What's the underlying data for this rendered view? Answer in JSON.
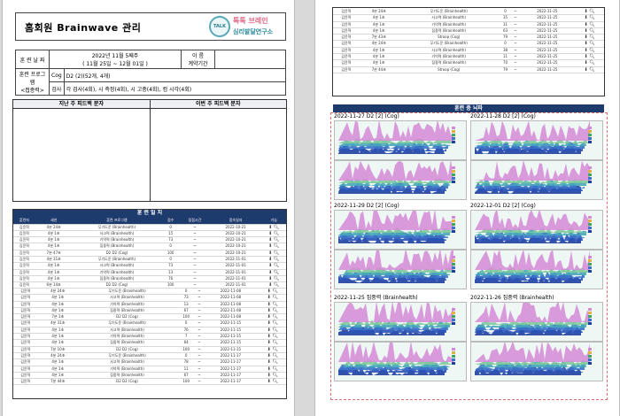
{
  "title": "홈회원 Brainwave 관리",
  "logo": {
    "line1": "톡톡 브레인",
    "line2": "심리발달연구소",
    "seal": "Brainwave"
  },
  "info": {
    "date_label": "훈 련 날 짜",
    "date_value1": "2022년 11월 5째주",
    "date_value2": "( 11월 25일 ~ 12월 01일 )",
    "name_label": "이 름",
    "name_value": "",
    "period_label": "계약기간",
    "period_value": "",
    "program_label": "훈련 프로그램",
    "program_sub": "<접종력>",
    "cog_label": "Cog",
    "cog_value": "D2 (2)(52개, 4개)",
    "etc_label": "검사",
    "etc_value": "각 검사(4회), 시 측정(4회), 시 고충(4회), 컴 시각(4회)"
  },
  "report": {
    "left": "지난 주 피드백 분자",
    "right": "이번 주 피드백 분자"
  },
  "log": {
    "title": "훈 련 일 지",
    "headers": [
      "훈련자",
      "세션",
      "훈련 프로그램",
      "점수",
      "점점시간",
      "접속일자",
      "기능"
    ],
    "rows1": [
      [
        "김윤혁",
        "4분 24초",
        "무기도운 (Brainhealth)",
        "0",
        "~",
        "2022-10-21"
      ],
      [
        "김윤혁",
        "4분 1초",
        "사고력 (Brainhealth)",
        "15",
        "~",
        "2022-10-21"
      ],
      [
        "김윤혁",
        "4분 1초",
        "기억력 (Brainhealth)",
        "73",
        "~",
        "2022-10-21"
      ],
      [
        "김윤혁",
        "4분 1초",
        "집중력 (Brainhealth)",
        "0",
        "~",
        "2022-10-21"
      ],
      [
        "김윤혁",
        "7분 47초",
        "D2 D2 (Cog)",
        "100",
        "~",
        "2022-10-21"
      ],
      [
        "김윤혁",
        "4분 31초",
        "무기도운 (Brainhealth)",
        "0",
        "~",
        "2022-11-01"
      ],
      [
        "김윤혁",
        "4분 1초",
        "사고력 (Brainhealth)",
        "73",
        "~",
        "2022-11-01"
      ],
      [
        "김윤혁",
        "4분 1초",
        "기억력 (Brainhealth)",
        "13",
        "~",
        "2022-11-01"
      ],
      [
        "김윤혁",
        "4분 1초",
        "집중력 (Brainhealth)",
        "76",
        "~",
        "2022-11-01"
      ],
      [
        "김윤혁",
        "6분 14초",
        "D2 D2 (Cog)",
        "100",
        "~",
        "2022-11-01"
      ]
    ],
    "rows2": [
      [
        "김윤혁",
        "4분 24초",
        "무기도운 (Brainhealth)",
        "0",
        "~",
        "2022-11-08"
      ],
      [
        "김윤혁",
        "4분 1초",
        "사고력 (Brainhealth)",
        "73",
        "~",
        "2022-11-08"
      ],
      [
        "김윤혁",
        "4분 1초",
        "기억력 (Brainhealth)",
        "13",
        "~",
        "2022-11-08"
      ],
      [
        "김윤혁",
        "4분 1초",
        "집중력 (Brainhealth)",
        "67",
        "~",
        "2022-11-08"
      ],
      [
        "김윤혁",
        "7분 1초",
        "D2 D2 (Cog)",
        "100",
        "~",
        "2022-11-08"
      ],
      [
        "김윤혁",
        "4분 31초",
        "무기도운 (Brainhealth)",
        "0",
        "~",
        "2022-11-15"
      ],
      [
        "김윤혁",
        "4분 1초",
        "사고력 (Brainhealth)",
        "76",
        "~",
        "2022-11-15"
      ],
      [
        "김윤혁",
        "4분 1초",
        "기억력 (Brainhealth)",
        "7",
        "~",
        "2022-11-15"
      ],
      [
        "김윤혁",
        "4분 1초",
        "집중력 (Brainhealth)",
        "64",
        "~",
        "2022-11-15"
      ],
      [
        "김윤혁",
        "7분 10초",
        "D2 D2 (Cog)",
        "100",
        "~",
        "2022-11-15"
      ],
      [
        "김윤혁",
        "4분 24초",
        "무기도운 (Brainhealth)",
        "0",
        "~",
        "2022-11-17"
      ],
      [
        "김윤혁",
        "4분 1초",
        "사고력 (Brainhealth)",
        "78",
        "~",
        "2022-11-17"
      ],
      [
        "김윤혁",
        "4분 1초",
        "기억력 (Brainhealth)",
        "11",
        "~",
        "2022-11-17"
      ],
      [
        "김윤혁",
        "4분 1초",
        "집중력 (Brainhealth)",
        "67",
        "~",
        "2022-11-17"
      ],
      [
        "김윤혁",
        "7분 44초",
        "D2 D2 (Cog)",
        "100",
        "~",
        "2022-11-17"
      ]
    ],
    "rows3": [
      [
        "김윤혁",
        "4분 24초",
        "무기도운 (Brainhealth)",
        "0",
        "~",
        "2022-11-25"
      ],
      [
        "김윤혁",
        "4분 1초",
        "사고력 (Brainhealth)",
        "35",
        "~",
        "2022-11-25"
      ],
      [
        "김윤혁",
        "4분 1초",
        "기억력 (Brainhealth)",
        "11",
        "~",
        "2022-11-25"
      ],
      [
        "김윤혁",
        "4분 1초",
        "집중력 (Brainhealth)",
        "63",
        "~",
        "2022-11-25"
      ],
      [
        "김윤혁",
        "7분 43초",
        "Stroop (Cog)",
        "79",
        "~",
        "2022-11-25"
      ],
      [
        "김윤혁",
        "4분 24초",
        "무기도운 (Brainhealth)",
        "0",
        "~",
        "2022-11-25"
      ],
      [
        "김윤혁",
        "4분 1초",
        "사고력 (Brainhealth)",
        "38",
        "~",
        "2022-11-25"
      ],
      [
        "김윤혁",
        "4분 1초",
        "기억력 (Brainhealth)",
        "11",
        "~",
        "2022-11-25"
      ],
      [
        "김윤혁",
        "4분 1초",
        "집중력 (Brainhealth)",
        "70",
        "~",
        "2022-11-25"
      ],
      [
        "김윤혁",
        "7분 44초",
        "Stroop (Cog)",
        "79",
        "~",
        "2022-11-25"
      ]
    ]
  },
  "eeg": {
    "title": "훈련 중 뇌파",
    "panels": [
      {
        "title": "2022-11-27 D2 [2] (Cog)"
      },
      {
        "title": "2022-11-28 D2 [2] (Cog)"
      },
      {
        "title": "2022-11-29 D2 [2] (Cog)"
      },
      {
        "title": "2022-12-01 D2 [2] (Cog)"
      },
      {
        "title": "2022-11-25 집중력 (Brainhealth)"
      },
      {
        "title": "2022-11-26 집중력 (Brainhealth)"
      }
    ]
  },
  "icons": {
    "download": "download-icon",
    "search": "search-icon"
  },
  "colors": {
    "header_navy": "#1e3b6e",
    "eeg_border": "#e07070",
    "eeg_pink": "#d38ad6",
    "eeg_blue": "#2a52b8"
  }
}
